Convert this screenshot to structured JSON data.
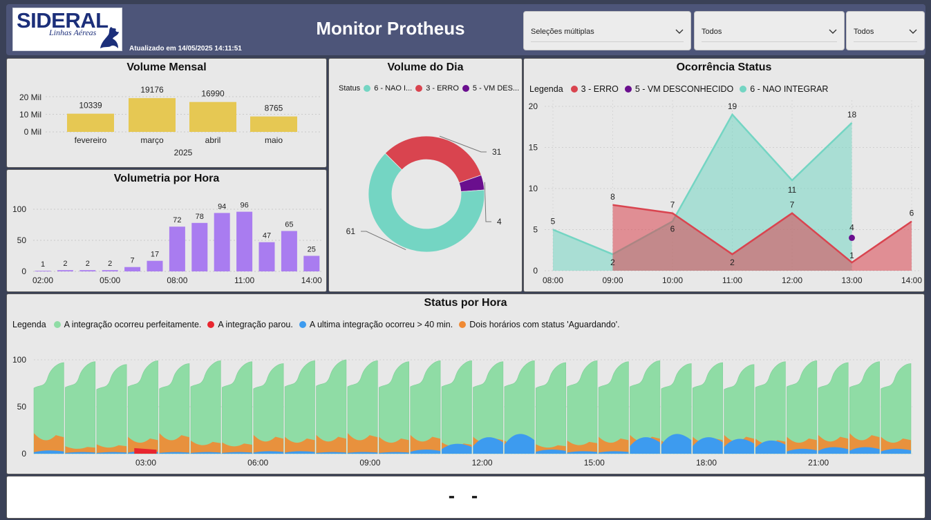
{
  "header": {
    "logo_main": "SIDERAL",
    "logo_sub": "Linhas Aéreas",
    "updated": "Atualizado em 14/05/2025 14:11:51",
    "title": "Monitor Protheus"
  },
  "slicers": [
    {
      "value": "Seleções múltiplas"
    },
    {
      "value": "Todos"
    },
    {
      "value": "Todos"
    }
  ],
  "volume_mensal": {
    "title": "Volume Mensal",
    "year_label": "2025",
    "y_ticks": [
      "20 Mil",
      "10 Mil",
      "0 Mil"
    ]
  },
  "volumetria": {
    "title": "Volumetria por Hora",
    "x_ticks": [
      "02:00",
      "05:00",
      "08:00",
      "11:00",
      "14:00"
    ]
  },
  "volume_dia": {
    "title": "Volume do Dia",
    "legend_title": "Status",
    "legend": [
      "6 - NAO I...",
      "3 - ERRO",
      "5 - VM DES..."
    ]
  },
  "ocorrencia": {
    "title": "Ocorrência Status",
    "legend_title": "Legenda",
    "legend": [
      "3 - ERRO",
      "5 - VM DESCONHECIDO",
      "6 - NAO INTEGRAR"
    ]
  },
  "status_hora": {
    "title": "Status por Hora",
    "legend_title": "Legenda",
    "legend": [
      "A integração ocorreu perfeitamente.",
      "A integração parou.",
      "A ultima integração ocorreu > 40 min.",
      "Dois horários com status 'Aguardando'."
    ],
    "x_ticks": [
      "03:00",
      "06:00",
      "09:00",
      "12:00",
      "15:00",
      "18:00",
      "21:00"
    ],
    "y_ticks": [
      "100",
      "50",
      "0"
    ]
  },
  "footer": {
    "text": "- -"
  },
  "colors": {
    "gold": "#e6c853",
    "purple": "#a97cf0",
    "teal": "#74d5c3",
    "red": "#d9444f",
    "darkpurple": "#6a0f8e",
    "green": "#8fdca5",
    "orange": "#f08a34",
    "blue": "#3d9bef",
    "stopred": "#e8262f"
  },
  "chart_data": [
    {
      "type": "bar",
      "title": "Volume Mensal",
      "categories": [
        "fevereiro",
        "março",
        "abril",
        "maio"
      ],
      "values": [
        10339,
        19176,
        16990,
        8765
      ],
      "ylim": [
        0,
        20000
      ]
    },
    {
      "type": "bar",
      "title": "Volumetria por Hora",
      "categories": [
        "02:00",
        "03:00",
        "04:00",
        "05:00",
        "06:00",
        "07:00",
        "08:00",
        "09:00",
        "10:00",
        "11:00",
        "12:00",
        "13:00",
        "14:00"
      ],
      "values": [
        1,
        2,
        2,
        2,
        7,
        17,
        72,
        78,
        94,
        96,
        47,
        65,
        25
      ],
      "ylim": [
        0,
        100
      ],
      "y_ticks": [
        0,
        50,
        100
      ]
    },
    {
      "type": "pie",
      "title": "Volume do Dia",
      "slices": [
        {
          "name": "6 - NAO I...",
          "value": 61
        },
        {
          "name": "3 - ERRO",
          "value": 31
        },
        {
          "name": "5 - VM DES...",
          "value": 4
        }
      ]
    },
    {
      "type": "area",
      "title": "Ocorrência Status",
      "categories": [
        "08:00",
        "09:00",
        "10:00",
        "11:00",
        "12:00",
        "13:00",
        "14:00"
      ],
      "ylim": [
        0,
        20
      ],
      "y_ticks": [
        0,
        5,
        10,
        15,
        20
      ],
      "series": [
        {
          "name": "3 - ERRO",
          "values": [
            null,
            8,
            7,
            2,
            7,
            1,
            6
          ]
        },
        {
          "name": "5 - VM DESCONHECIDO",
          "values": [
            null,
            null,
            null,
            null,
            null,
            4,
            null
          ]
        },
        {
          "name": "6 - NAO INTEGRAR",
          "values": [
            5,
            2,
            6,
            19,
            11,
            18,
            null
          ]
        }
      ]
    },
    {
      "type": "area",
      "title": "Status por Hora",
      "ylim": [
        0,
        110
      ],
      "x_ticks": [
        "03:00",
        "06:00",
        "09:00",
        "12:00",
        "15:00",
        "18:00",
        "21:00"
      ],
      "series": [
        {
          "name": "A integração ocorreu perfeitamente.",
          "values": [
            97,
            98,
            95,
            99,
            96,
            99,
            98,
            96,
            99,
            100,
            99,
            98,
            99,
            99,
            98,
            99,
            97,
            99,
            98,
            99,
            96,
            97,
            95,
            98,
            99,
            97,
            98,
            96
          ]
        },
        {
          "name": "A integração parou.",
          "values": [
            0,
            0,
            0,
            6,
            0,
            0,
            0,
            0,
            0,
            0,
            0,
            0,
            0,
            0,
            0,
            0,
            0,
            0,
            0,
            0,
            0,
            0,
            0,
            0,
            0,
            0,
            0,
            0
          ]
        },
        {
          "name": "A ultima integração ocorreu > 40 min.",
          "values": [
            4,
            2,
            2,
            3,
            2,
            2,
            2,
            3,
            3,
            2,
            2,
            2,
            5,
            12,
            20,
            24,
            5,
            3,
            3,
            20,
            24,
            20,
            18,
            16,
            6,
            8,
            8,
            6
          ]
        },
        {
          "name": "Dois horários com status 'Aguardando'.",
          "values": [
            22,
            8,
            10,
            18,
            22,
            14,
            12,
            20,
            18,
            20,
            22,
            18,
            20,
            12,
            18,
            14,
            10,
            14,
            18,
            20,
            14,
            18,
            20,
            16,
            18,
            20,
            22,
            18
          ]
        }
      ]
    }
  ]
}
